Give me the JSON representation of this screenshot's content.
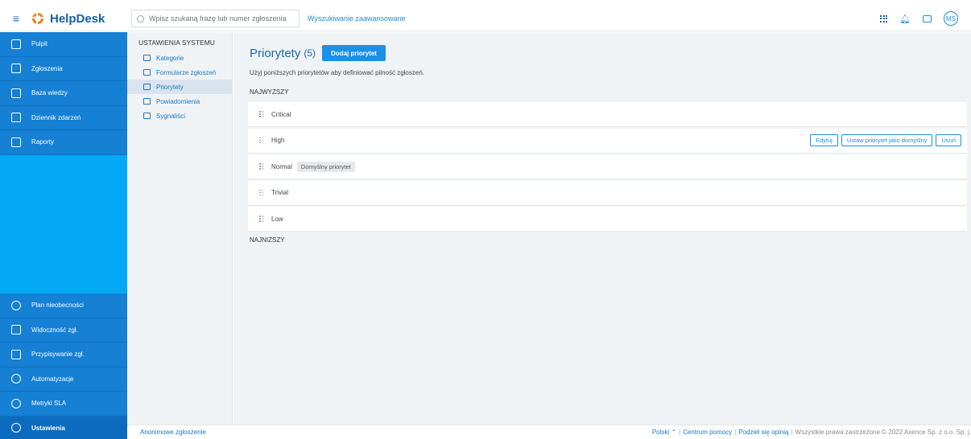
{
  "header": {
    "logo": "HelpDesk",
    "search_placeholder": "Wpisz szukaną frazę lub numer zgłoszenia",
    "advanced_search": "Wyszukiwanie zaawansowane",
    "avatar": "MS"
  },
  "sidebar": {
    "top_items": [
      "Pulpit",
      "Zgłoszenia",
      "Baza wiedzy",
      "Dziennik zdarzeń",
      "Raporty"
    ],
    "bottom_items": [
      "Plan nieobecności",
      "Widoczność zgł.",
      "Przypisywanie zgł.",
      "Automatyzacje",
      "Metryki SLA",
      "Ustawienia"
    ]
  },
  "settings": {
    "title": "USTAWIENIA SYSTEMU",
    "items": [
      "Kategorie",
      "Formularze zgłoszeń",
      "Priorytety",
      "Powiadomienia",
      "Sygnaliści"
    ]
  },
  "main": {
    "title": "Priorytety",
    "count": "(5)",
    "add_button": "Dodaj priorytet",
    "description": "Użyj poniższych priorytetów aby definiować pilność zgłoszeń.",
    "highest_label": "NAJWYŻSZY",
    "lowest_label": "NAJNIŻSZY",
    "priorities": [
      "Critical",
      "High",
      "Normal",
      "Trivial",
      "Low"
    ],
    "default_badge": "Domyślny priorytet",
    "actions": {
      "edit": "Edytuj",
      "set_default": "Ustaw priorytet jako domyślny",
      "delete": "Usuń"
    }
  },
  "footer": {
    "anonymous": "Anonimowe zgłoszenie",
    "language": "Polski",
    "help": "Centrum pomocy",
    "feedback": "Podziel się opinią",
    "copyright": "Wszystkie prawa zastrzeżone © 2022 Axence Sp. z o.o. Sp. j."
  }
}
